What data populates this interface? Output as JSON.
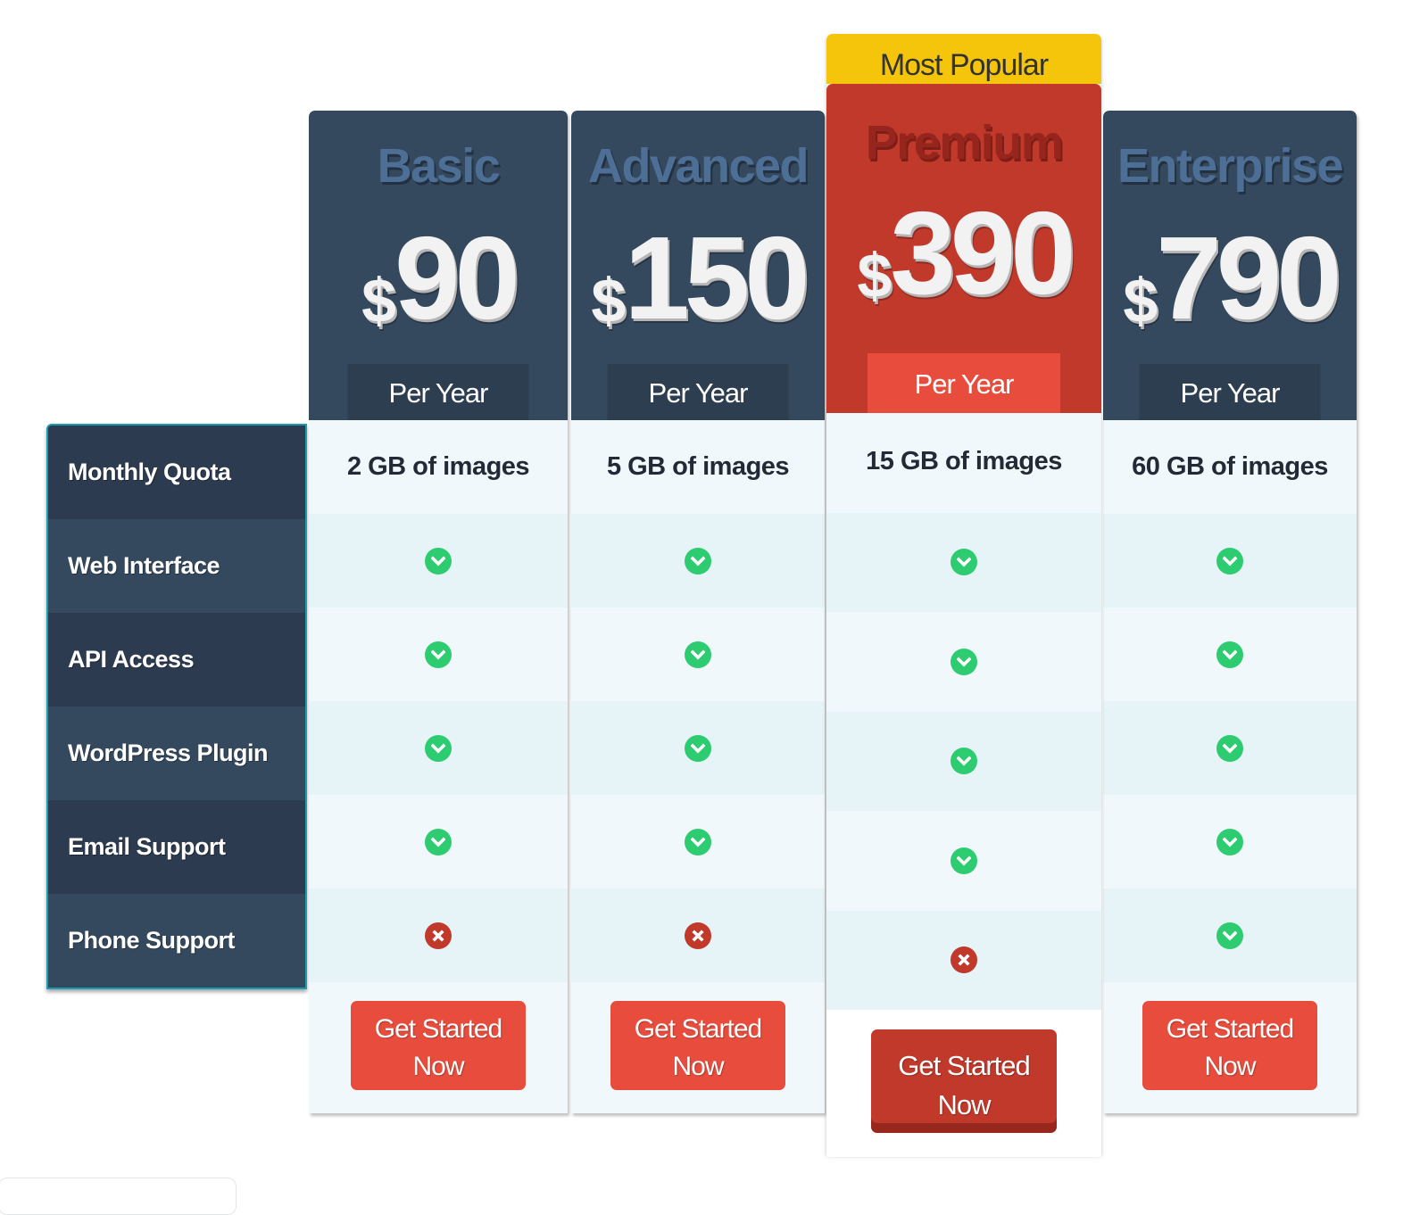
{
  "features": [
    "Monthly Quota",
    "Web Interface",
    "API Access",
    "WordPress Plugin",
    "Email Support",
    "Phone Support"
  ],
  "plans": [
    {
      "name": "Basic",
      "currency": "$",
      "price": "90",
      "period": "Per Year",
      "quota": "2 GB of images",
      "included": [
        "yes",
        "yes",
        "yes",
        "yes",
        "no"
      ],
      "cta_line1": "Get Started",
      "cta_line2": "Now",
      "featured": false
    },
    {
      "name": "Advanced",
      "currency": "$",
      "price": "150",
      "period": "Per Year",
      "quota": "5 GB of images",
      "included": [
        "yes",
        "yes",
        "yes",
        "yes",
        "no"
      ],
      "cta_line1": "Get Started",
      "cta_line2": "Now",
      "featured": false
    },
    {
      "name": "Premium",
      "badge": "Most Popular",
      "currency": "$",
      "price": "390",
      "period": "Per Year",
      "quota": "15 GB of images",
      "included": [
        "yes",
        "yes",
        "yes",
        "yes",
        "no"
      ],
      "cta_line1": "Get Started",
      "cta_line2": "Now",
      "featured": true
    },
    {
      "name": "Enterprise",
      "currency": "$",
      "price": "790",
      "period": "Per Year",
      "quota": "60 GB of images",
      "included": [
        "yes",
        "yes",
        "yes",
        "yes",
        "yes"
      ],
      "cta_line1": "Get Started",
      "cta_line2": "Now",
      "featured": false
    }
  ],
  "icons": {
    "yes": "check-circle-icon",
    "no": "x-circle-icon"
  },
  "colors": {
    "header_dark": "#34495e",
    "featured_red": "#c0392b",
    "badge_yellow": "#f5c50c",
    "cta_red": "#e74c3c",
    "check_green": "#2ecc71",
    "cross_red": "#c0392b"
  }
}
